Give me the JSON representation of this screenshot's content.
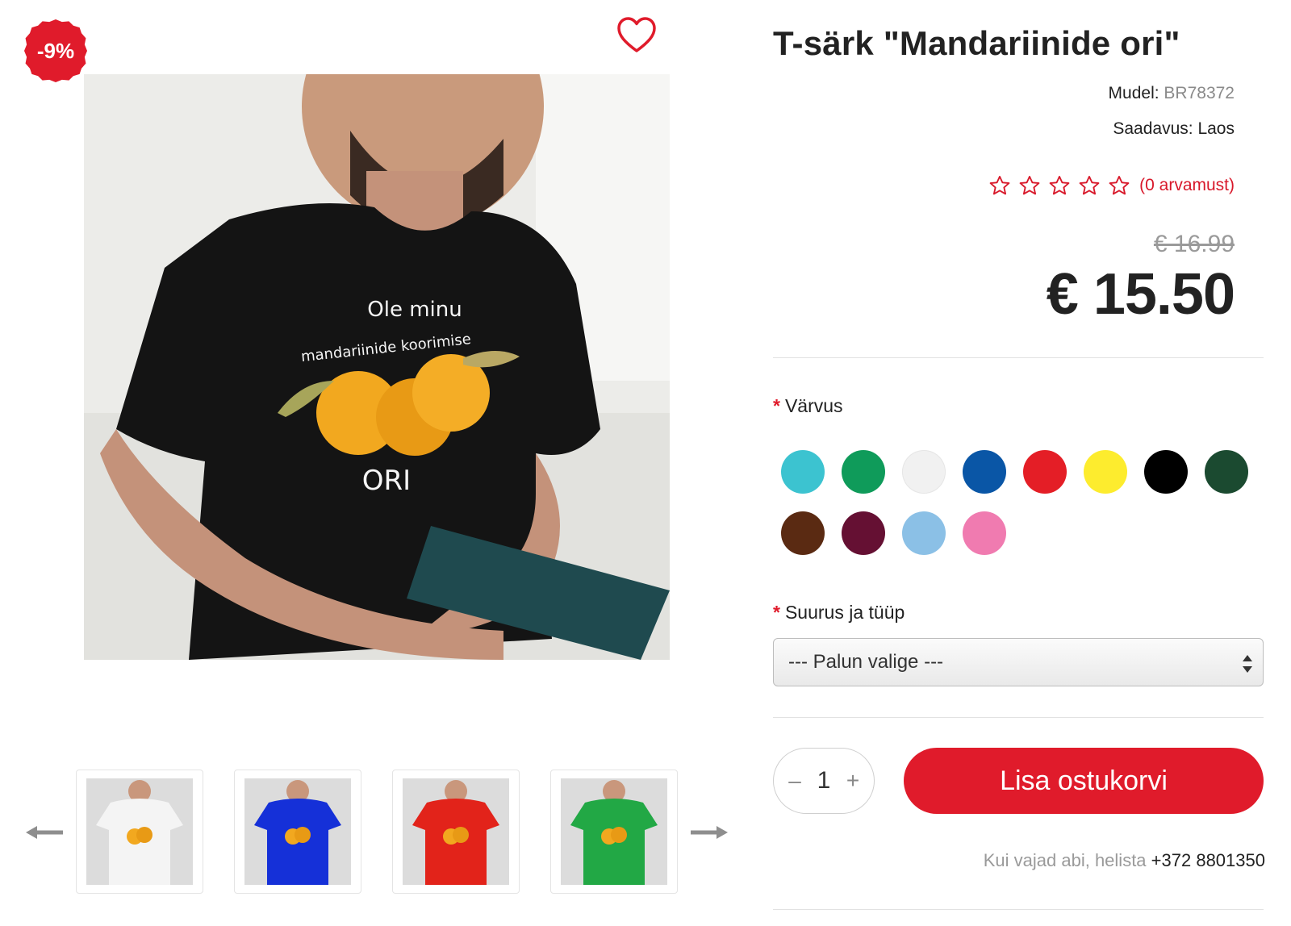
{
  "product": {
    "title": "T-särk \"Mandariinide ori\"",
    "discount_badge": "-9%",
    "model_label": "Mudel:",
    "model_value": "BR78372",
    "availability_label": "Saadavus:",
    "availability_value": "Laos",
    "rating": {
      "stars": 0,
      "max": 5,
      "reviews_text": "(0 arvamust)"
    },
    "old_price": "€ 16.99",
    "price": "€ 15.50"
  },
  "shirt_print": {
    "line1": "Ole minu",
    "line2": "mandariinide koorimise",
    "line3": "ORI"
  },
  "options": {
    "color_label": "Värvus",
    "colors": [
      "#3cc3d0",
      "#0f9b5a",
      "#f1f1f1",
      "#0a56a6",
      "#e41e26",
      "#fdec2e",
      "#000000",
      "#1b4a30",
      "#5a2a12",
      "#651033",
      "#8bc0e6",
      "#f07bb0"
    ],
    "size_label": "Suurus ja tüüp",
    "size_placeholder": "--- Palun valige ---"
  },
  "cart": {
    "quantity": "1",
    "minus": "–",
    "plus": "+",
    "add_label": "Lisa ostukorvi"
  },
  "help": {
    "text": "Kui vajad abi, helista",
    "phone": "+372 8801350"
  },
  "thumbnails": [
    {
      "shirt_color": "#f4f4f4"
    },
    {
      "shirt_color": "#1530d8"
    },
    {
      "shirt_color": "#e2231a"
    },
    {
      "shirt_color": "#22a845"
    }
  ],
  "colors": {
    "accent": "#e01b2b",
    "text": "#222222",
    "muted": "#9a9a9a"
  }
}
